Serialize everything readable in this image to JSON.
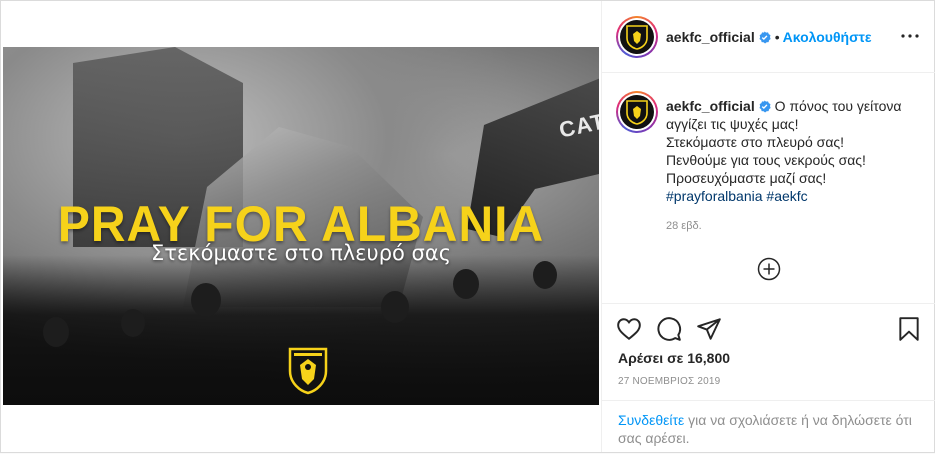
{
  "post": {
    "image": {
      "title_text": "PRAY FOR ALBANIA",
      "subtitle_text": "Στεκόμαστε στο πλευρό σας",
      "machinery_text": "CAT"
    },
    "header": {
      "username": "aekfc_official",
      "separator": "•",
      "follow_label": "Ακολουθήστε",
      "more_label": "more options"
    },
    "caption": {
      "username": "aekfc_official",
      "lines": [
        "Ο πόνος του γείτονα αγγίζει τις ψυχές μας!",
        "Στεκόμαστε στο πλευρό σας!",
        "Πενθούμε για τους νεκρούς σας!",
        "Προσευχόμαστε μαζί σας!"
      ],
      "hashtags": [
        "#prayforalbania",
        "#aekfc"
      ],
      "time_ago": "28 εβδ."
    },
    "likes_text": "Αρέσει σε 16,800",
    "date_text": "27 ΝΟΕΜΒΡΙΟΣ 2019",
    "login_prompt": {
      "link": "Συνδεθείτε",
      "rest": " για να σχολιάσετε ή να δηλώσετε ότι σας αρέσει."
    },
    "colors": {
      "accent_blue": "#0095f6",
      "hashtag_blue": "#00376b",
      "title_yellow": "#f6d21a",
      "verified_blue": "#3897f0"
    },
    "icons": [
      "verified-icon",
      "more-icon",
      "add-comment-icon",
      "heart-icon",
      "comment-icon",
      "share-icon",
      "bookmark-icon",
      "aek-crest-icon"
    ]
  }
}
